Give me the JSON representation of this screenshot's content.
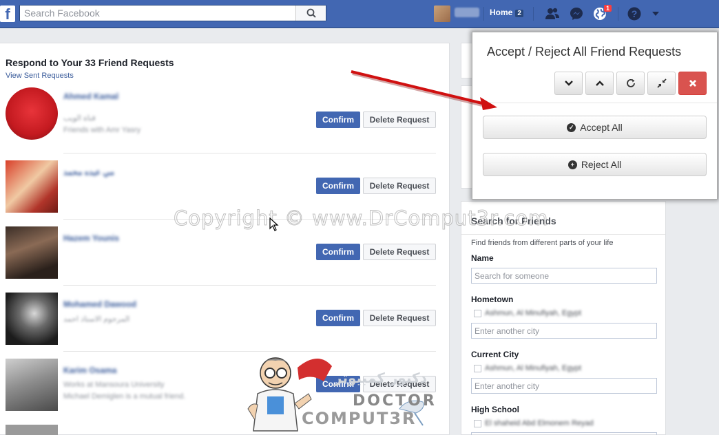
{
  "topbar": {
    "logo": "f",
    "search_placeholder": "Search Facebook",
    "home_label": "Home",
    "home_count": "2",
    "notifications_count": "1"
  },
  "requests": {
    "title": "Respond to Your 33 Friend Requests",
    "view_sent": "View Sent Requests",
    "confirm_label": "Confirm",
    "delete_label": "Delete Request",
    "items": [
      {
        "name": "Ahmed Kamal",
        "line1": "قناة الويب",
        "line2": "Friends with Amr Yasry"
      },
      {
        "name": "مي عبده محمد",
        "line1": "",
        "line2": ""
      },
      {
        "name": "Hazem Younis",
        "line1": "",
        "line2": ""
      },
      {
        "name": "Mohamed Dawood",
        "line1": "المرحوم الاستاذ احمد",
        "line2": ""
      },
      {
        "name": "Karim Osama",
        "line1": "Works at Mansoura University",
        "line2": "Michael Demiglen is a mutual friend."
      }
    ]
  },
  "popup": {
    "title": "Accept / Reject All Friend Requests",
    "accept_all": "Accept All",
    "reject_all": "Reject All"
  },
  "search_friends": {
    "title": "Search for Friends",
    "subtitle": "Find friends from different parts of your life",
    "name_label": "Name",
    "name_placeholder": "Search for someone",
    "hometown_label": "Hometown",
    "hometown_option": "Ashmun, Al Minufiyah, Egypt",
    "city_placeholder": "Enter another city",
    "current_city_label": "Current City",
    "current_city_option": "Ashmun, Al Minufiyah, Egypt",
    "high_school_label": "High School",
    "high_school_option": "El shaheid Abd Elmonem Reyad"
  },
  "watermark": {
    "text": "Copyright © www.DrComput3r.com",
    "logo_arabic": "دكتور كمبيوتر",
    "logo_doctor": "DOCTOR",
    "logo_computer": "COMPUT3R"
  },
  "colors": {
    "fb_blue": "#4267b2",
    "danger": "#d9534f",
    "arrow_red": "#d01010"
  }
}
